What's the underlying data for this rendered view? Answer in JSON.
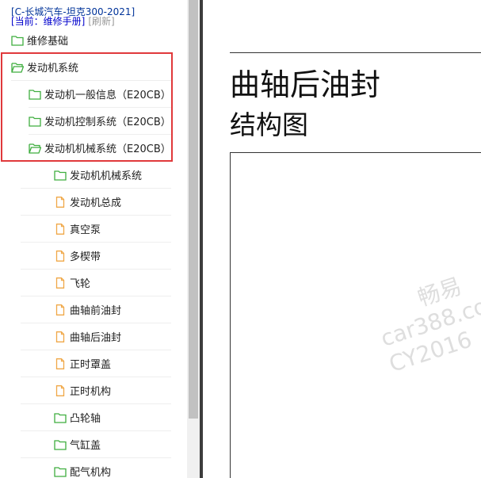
{
  "header": {
    "manual_title": "[C-长城汽车-坦克300-2021]",
    "current_prefix": "[当前：维修手册]",
    "refresh_label": "[刷新]"
  },
  "tree": [
    {
      "label": "维修基础",
      "icon": "folder-icon"
    },
    {
      "label": "发动机系统",
      "icon": "folder-open-icon"
    },
    {
      "label": "发动机一般信息（E20CB）",
      "icon": "folder-icon"
    },
    {
      "label": "发动机控制系统（E20CB）",
      "icon": "folder-icon"
    },
    {
      "label": "发动机机械系统（E20CB）",
      "icon": "folder-open-icon"
    },
    {
      "label": "发动机机械系统",
      "icon": "folder-icon"
    },
    {
      "label": "发动机总成",
      "icon": "file-icon"
    },
    {
      "label": "真空泵",
      "icon": "file-icon"
    },
    {
      "label": "多楔带",
      "icon": "file-icon"
    },
    {
      "label": "飞轮",
      "icon": "file-icon"
    },
    {
      "label": "曲轴前油封",
      "icon": "file-icon"
    },
    {
      "label": "曲轴后油封",
      "icon": "file-icon"
    },
    {
      "label": "正时罩盖",
      "icon": "file-icon"
    },
    {
      "label": "正时机构",
      "icon": "file-icon"
    },
    {
      "label": "凸轮轴",
      "icon": "folder-icon"
    },
    {
      "label": "气缸盖",
      "icon": "folder-icon"
    },
    {
      "label": "配气机构",
      "icon": "folder-icon"
    }
  ],
  "content": {
    "title": "曲轴后油封",
    "subtitle": "结构图"
  },
  "watermark": {
    "line1": "畅易",
    "line2": "car388.com",
    "line3": "CY2016"
  },
  "colors": {
    "folder": "#3fae3f",
    "file": "#f0a848",
    "highlight": "#e0393b",
    "link": "#0000cc"
  }
}
